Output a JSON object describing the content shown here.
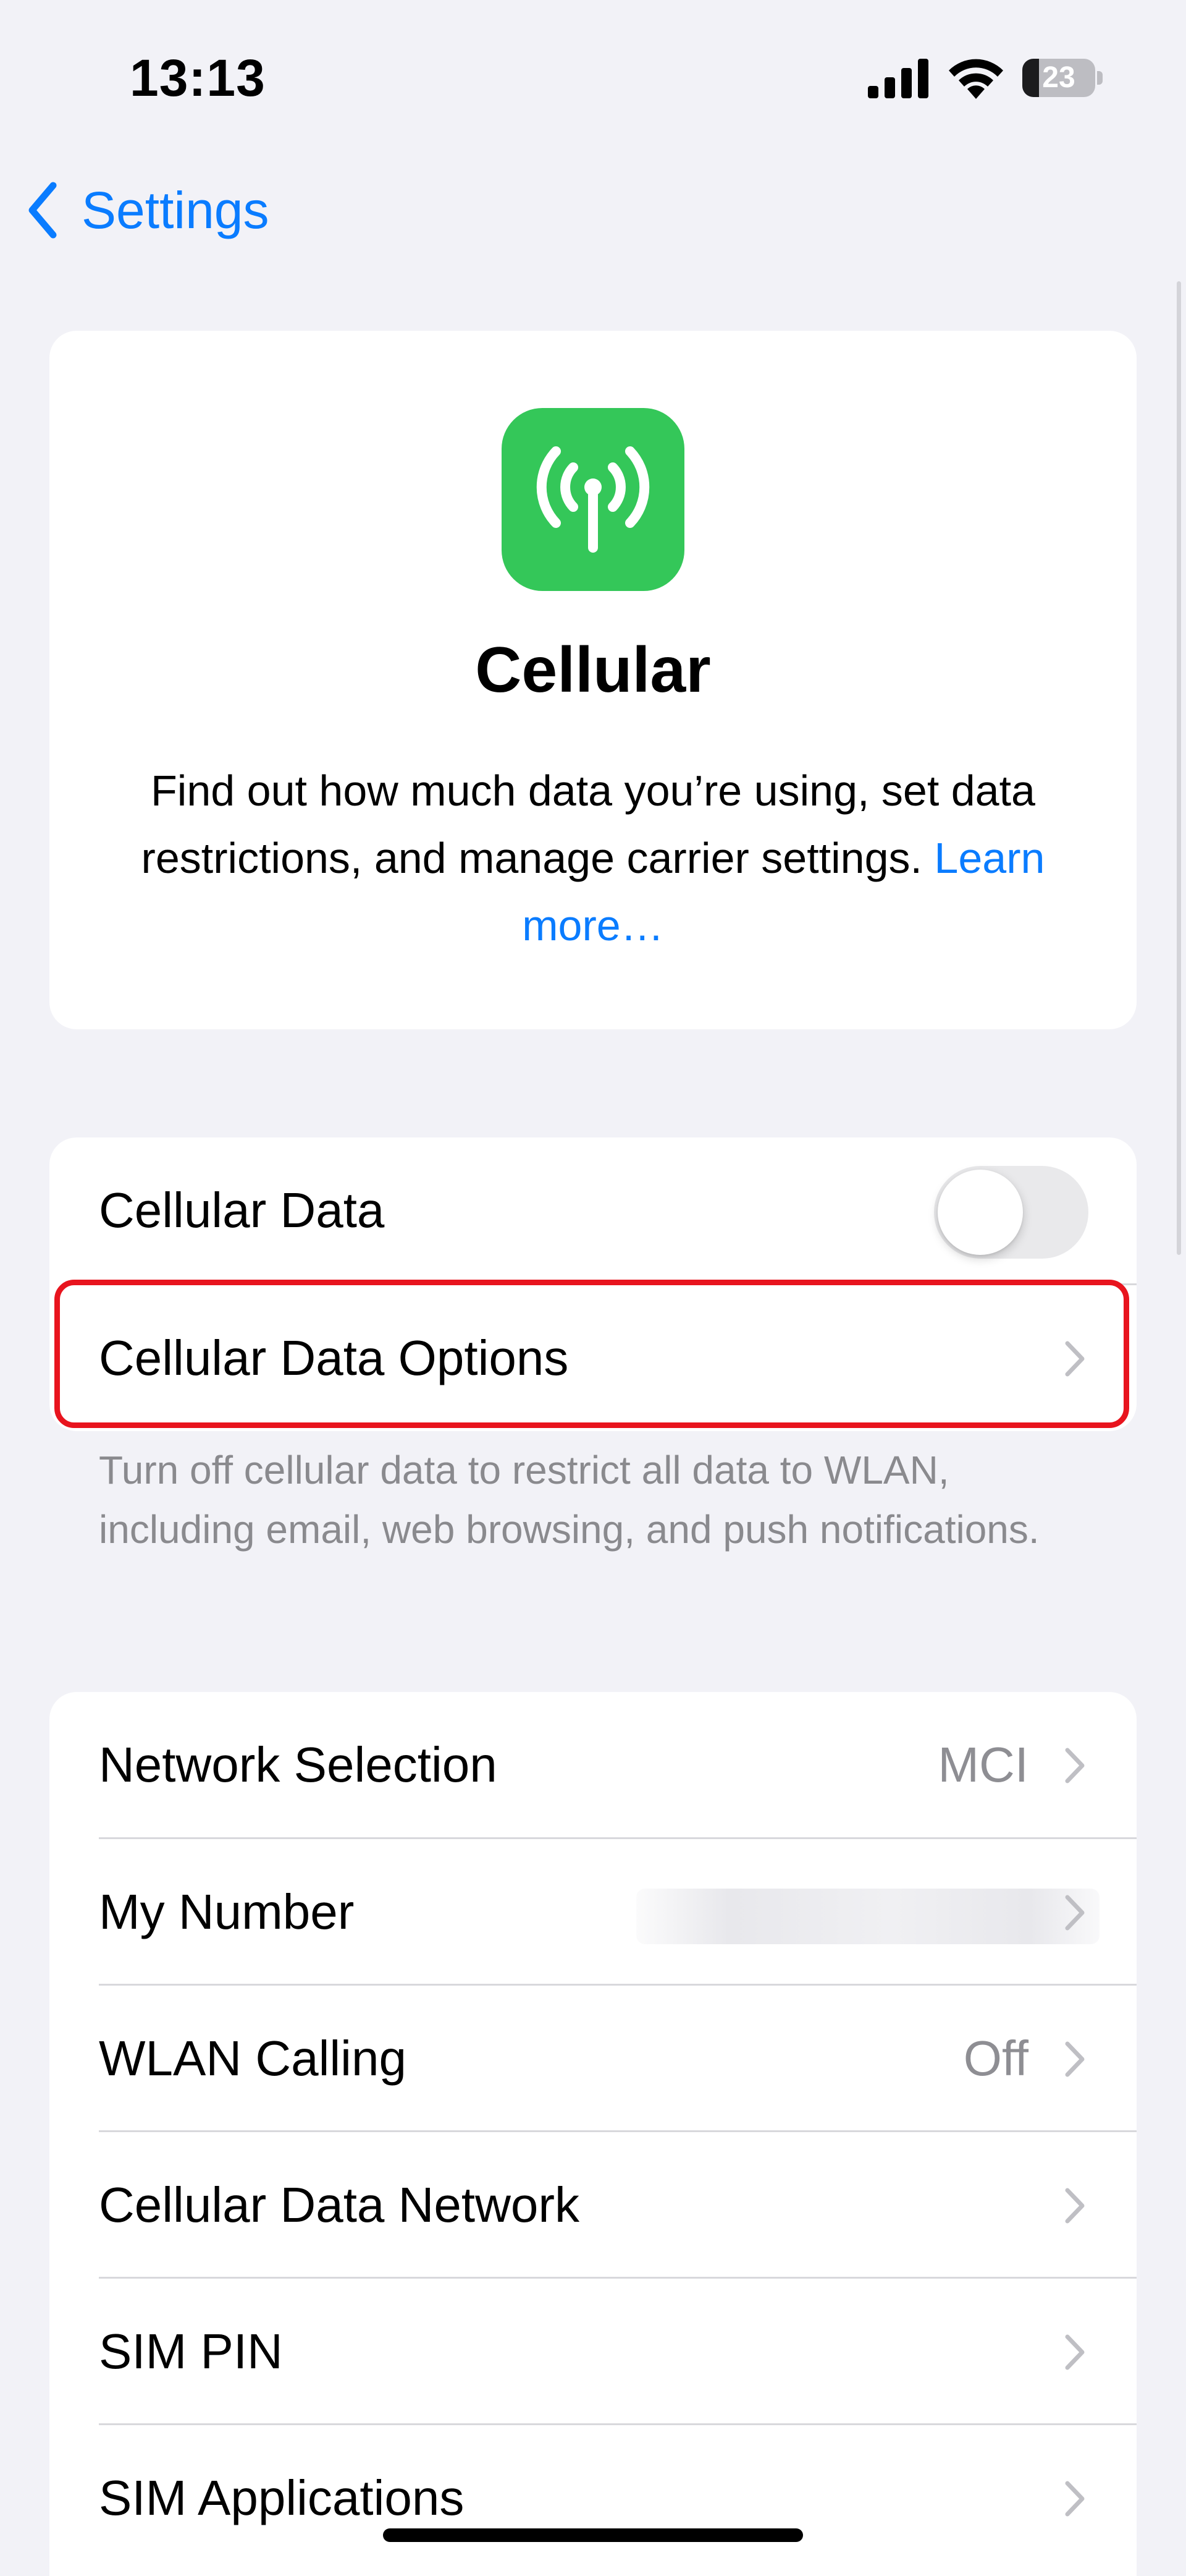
{
  "status_bar": {
    "time": "13:13",
    "battery_percent": "23",
    "battery_level": 0.23
  },
  "nav": {
    "back_label": "Settings",
    "back_icon": "chevron-left-icon"
  },
  "intro": {
    "icon": "antenna-radiowaves-icon",
    "icon_color": "#34C759",
    "title": "Cellular",
    "description": "Find out how much data you’re using, set data restrictions, and manage carrier settings.",
    "link_text": "Learn more…"
  },
  "data_section": {
    "cellular_data_label": "Cellular Data",
    "cellular_data_on": false,
    "options_label": "Cellular Data Options",
    "footer": "Turn off cellular data to restrict all data to WLAN, including email, web browsing, and push notifications."
  },
  "network_section": {
    "network_selection": {
      "label": "Network Selection",
      "value": "MCI"
    },
    "my_number": {
      "label": "My Number"
    },
    "wlan_calling": {
      "label": "WLAN Calling",
      "value": "Off"
    },
    "cellular_data_network": {
      "label": "Cellular Data Network"
    },
    "sim_pin": {
      "label": "SIM PIN"
    },
    "sim_applications": {
      "label": "SIM Applications"
    }
  },
  "colors": {
    "accent": "#0A7CFF",
    "highlight": "#E8141E",
    "background": "#F2F2F7"
  }
}
